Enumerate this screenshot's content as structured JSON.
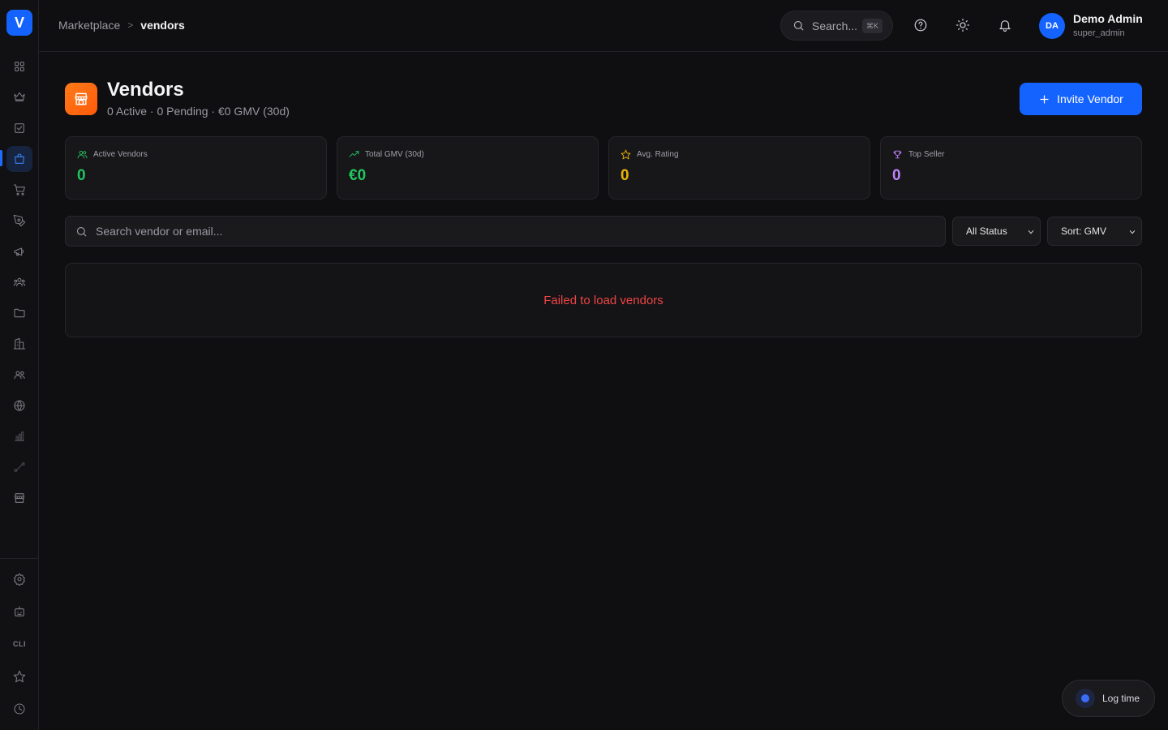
{
  "app": {
    "logo_letter": "V"
  },
  "breadcrumb": {
    "parent": "Marketplace",
    "current": "vendors"
  },
  "topbar": {
    "search_label": "Search...",
    "search_shortcut": "⌘K",
    "user": {
      "initials": "DA",
      "name": "Demo Admin",
      "role": "super_admin"
    }
  },
  "sidebar": {
    "items": [
      {
        "icon": "dashboard-grid-icon"
      },
      {
        "icon": "crown-icon"
      },
      {
        "icon": "checkbox-icon"
      },
      {
        "icon": "shopping-bag-icon",
        "active": true
      },
      {
        "icon": "shopping-cart-icon"
      },
      {
        "icon": "pen-tool-icon"
      },
      {
        "icon": "megaphone-icon"
      },
      {
        "icon": "users-group-icon"
      },
      {
        "icon": "folder-icon"
      },
      {
        "icon": "building-icon"
      },
      {
        "icon": "contacts-icon"
      },
      {
        "icon": "globe-icon"
      },
      {
        "icon": "bar-chart-icon"
      },
      {
        "icon": "route-icon"
      },
      {
        "icon": "store-icon"
      }
    ],
    "bottom_items": [
      {
        "icon": "settings-gear-icon"
      },
      {
        "icon": "bot-icon"
      },
      {
        "icon": "cli-icon",
        "label": "CLI"
      },
      {
        "icon": "star-icon"
      },
      {
        "icon": "clock-icon"
      }
    ]
  },
  "header": {
    "title": "Vendors",
    "subtitle": "0 Active · 0 Pending · €0 GMV (30d)",
    "invite_button": "Invite Vendor"
  },
  "stats": [
    {
      "label": "Active Vendors",
      "value": "0",
      "color": "#22c55e",
      "icon": "users-icon"
    },
    {
      "label": "Total GMV (30d)",
      "value": "€0",
      "color": "#22c55e",
      "icon": "trending-up-icon"
    },
    {
      "label": "Avg. Rating",
      "value": "0",
      "color": "#eab308",
      "icon": "star-icon"
    },
    {
      "label": "Top Seller",
      "value": "0",
      "color": "#c084fc",
      "icon": "trophy-icon"
    }
  ],
  "filters": {
    "search_placeholder": "Search vendor or email...",
    "status_selected": "All Status",
    "sort_selected": "Sort: GMV"
  },
  "error": {
    "message": "Failed to load vendors"
  },
  "log_time": {
    "label": "Log time"
  },
  "colors": {
    "accent": "#1463ff",
    "error": "#ef4444",
    "page_icon": "#ff6a10"
  }
}
